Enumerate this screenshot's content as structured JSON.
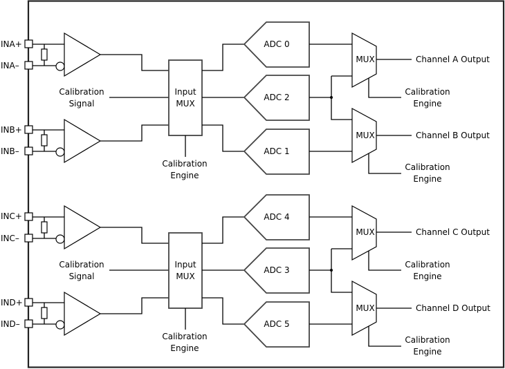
{
  "diagram": {
    "inputs": [
      {
        "pos": "INA+",
        "neg": "INA–"
      },
      {
        "pos": "INB+",
        "neg": "INB–"
      },
      {
        "pos": "INC+",
        "neg": "INC–"
      },
      {
        "pos": "IND+",
        "neg": "IND–"
      }
    ],
    "groups": [
      {
        "cal_signal": [
          "Calibration",
          "Signal"
        ],
        "input_mux": [
          "Input",
          "MUX"
        ],
        "cal_engine": [
          "Calibration",
          "Engine"
        ],
        "adcs": [
          "ADC 0",
          "ADC 2",
          "ADC 1"
        ],
        "muxes": [
          {
            "label": "MUX",
            "output": "Channel A Output",
            "engine": [
              "Calibration",
              "Engine"
            ]
          },
          {
            "label": "MUX",
            "output": "Channel B Output",
            "engine": [
              "Calibration",
              "Engine"
            ]
          }
        ]
      },
      {
        "cal_signal": [
          "Calibration",
          "Signal"
        ],
        "input_mux": [
          "Input",
          "MUX"
        ],
        "cal_engine": [
          "Calibration",
          "Engine"
        ],
        "adcs": [
          "ADC 4",
          "ADC 3",
          "ADC 5"
        ],
        "muxes": [
          {
            "label": "MUX",
            "output": "Channel C Output",
            "engine": [
              "Calibration",
              "Engine"
            ]
          },
          {
            "label": "MUX",
            "output": "Channel D Output",
            "engine": [
              "Calibration",
              "Engine"
            ]
          }
        ]
      }
    ]
  }
}
